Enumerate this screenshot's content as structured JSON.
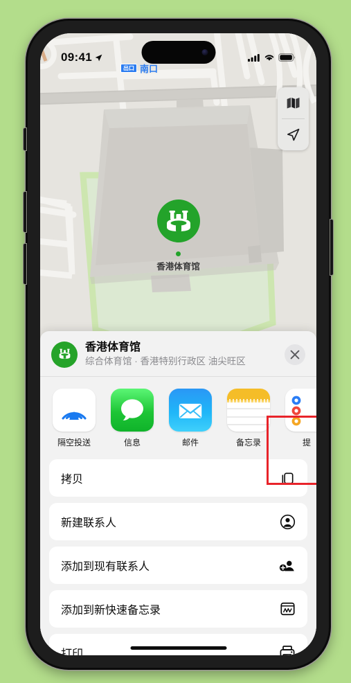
{
  "status_bar": {
    "time": "09:41",
    "location_arrow_icon": "location-arrow-icon",
    "cellular_icon": "cellular-bars-icon",
    "wifi_icon": "wifi-icon",
    "battery_icon": "battery-full-icon"
  },
  "map": {
    "transit_badge": "出口",
    "transit_label": "南口",
    "place_label": "香港体育馆",
    "pin_icon": "stadium-pin-icon",
    "controls": {
      "layers_icon": "map-layers-icon",
      "locate_icon": "location-arrow-icon"
    },
    "colors": {
      "land": "#e6e4df",
      "building": "#cfcdc8",
      "road": "#f4f3f0",
      "major_road": "#c9c7c2",
      "park_path": "#cde6b0",
      "pin_green": "#23a32a",
      "transit_blue": "#2b7cf0"
    }
  },
  "share_sheet": {
    "header": {
      "icon": "stadium-circle-icon",
      "title": "香港体育馆",
      "subtitle": "综合体育馆 · 香港特别行政区 油尖旺区",
      "close_icon": "close-icon"
    },
    "apps": [
      {
        "label": "隔空投送",
        "icon": "airdrop-icon",
        "highlighted": false
      },
      {
        "label": "信息",
        "icon": "messages-icon",
        "highlighted": false
      },
      {
        "label": "邮件",
        "icon": "mail-icon",
        "highlighted": false
      },
      {
        "label": "备忘录",
        "icon": "notes-icon",
        "highlighted": true
      },
      {
        "label": "提",
        "icon": "reminders-icon",
        "highlighted": false
      }
    ],
    "actions": [
      {
        "label": "拷贝",
        "icon": "copy-icon"
      },
      {
        "label": "新建联系人",
        "icon": "person-circle-icon"
      },
      {
        "label": "添加到现有联系人",
        "icon": "person-badge-plus-icon"
      },
      {
        "label": "添加到新快速备忘录",
        "icon": "quick-note-icon"
      },
      {
        "label": "打印",
        "icon": "printer-icon"
      }
    ],
    "highlight_color": "#e8232a"
  },
  "home_indicator": "home-indicator"
}
